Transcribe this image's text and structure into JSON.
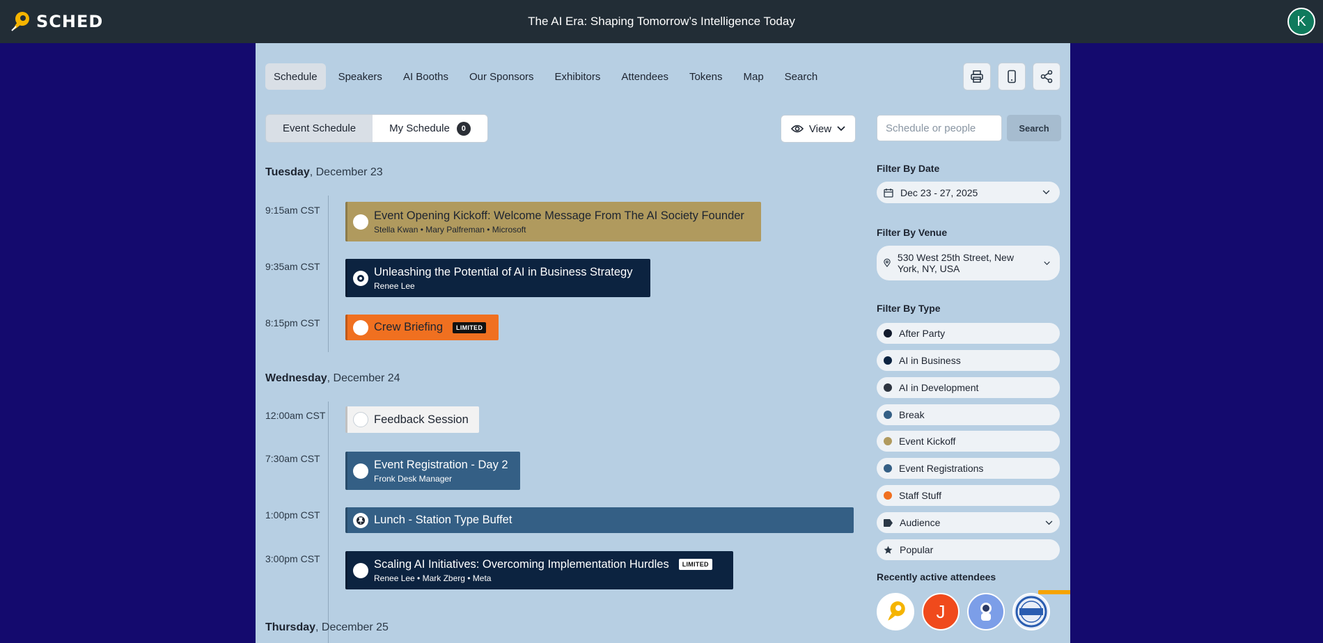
{
  "app": {
    "logo_text": "SCHED",
    "event_title": "The AI Era: Shaping Tomorrow’s Intelligence Today",
    "user_initial": "K"
  },
  "nav": {
    "tabs": [
      "Schedule",
      "Speakers",
      "AI Booths",
      "Our Sponsors",
      "Exhibitors",
      "Attendees",
      "Tokens",
      "Map",
      "Search"
    ],
    "active": "Schedule"
  },
  "toolbar": {
    "icons": [
      "printer-icon",
      "mobile-icon",
      "share-icon"
    ]
  },
  "schedule_tabs": {
    "event_schedule": "Event Schedule",
    "my_schedule": "My Schedule",
    "my_schedule_count": "0"
  },
  "view_button": {
    "label": "View"
  },
  "search": {
    "placeholder": "Schedule or people",
    "button": "Search"
  },
  "days": [
    {
      "weekday": "Tuesday",
      "date": ", December 23",
      "sessions": [
        {
          "time": "9:15am CST",
          "title": "Event Opening Kickoff: Welcome Message From The AI Society Founder",
          "subtitle": "Stella Kwan • Mary Palfreman • Microsoft",
          "color": "#b09a5e",
          "text_color": "#1d2430"
        },
        {
          "time": "9:35am CST",
          "title": "Unleashing the Potential of AI in Business Strategy",
          "subtitle": "Renee Lee",
          "color": "#0c2340",
          "text_color": "#ffffff"
        },
        {
          "time": "8:15pm CST",
          "title": "Crew Briefing",
          "badge": "LIMITED",
          "color": "#f07020",
          "text_color": "#1d2430"
        }
      ]
    },
    {
      "weekday": "Wednesday",
      "date": ", December 24",
      "sessions": [
        {
          "time": "12:00am CST",
          "title": "Feedback Session",
          "color": "#f2f2f2",
          "text_color": "#1d2430"
        },
        {
          "time": "7:30am CST",
          "title": "Event Registration - Day 2",
          "subtitle": "Fronk Desk Manager",
          "color": "#345f85",
          "text_color": "#ffffff"
        },
        {
          "time": "1:00pm CST",
          "title": "Lunch - Station Type Buffet",
          "color": "#345f85",
          "text_color": "#ffffff"
        },
        {
          "time": "3:00pm CST",
          "title": "Scaling AI Initiatives: Overcoming Implementation Hurdles",
          "subtitle": "Renee Lee • Mark Zberg • Meta",
          "badge": "LIMITED",
          "color": "#0c2340",
          "text_color": "#ffffff"
        }
      ]
    },
    {
      "weekday": "Thursday",
      "date": ", December 25"
    }
  ],
  "sidebar": {
    "filter_date_label": "Filter By Date",
    "filter_date_value": "Dec 23 - 27, 2025",
    "filter_venue_label": "Filter By Venue",
    "filter_venue_value": "530 West 25th Street, New York, NY, USA",
    "filter_type_label": "Filter By Type",
    "types": [
      {
        "name": "After Party",
        "color": "#111a2c"
      },
      {
        "name": "AI in Business",
        "color": "#0c2340"
      },
      {
        "name": "AI in Development",
        "color": "#2e3540"
      },
      {
        "name": "Break",
        "color": "#345f85"
      },
      {
        "name": "Event Kickoff",
        "color": "#b09a5e"
      },
      {
        "name": "Event Registrations",
        "color": "#345f85"
      },
      {
        "name": "Staff Stuff",
        "color": "#f07020"
      }
    ],
    "audience_label": "Audience",
    "popular_label": "Popular",
    "recent_label": "Recently active attendees",
    "attendees": [
      {
        "name": "sched-logo-avatar",
        "initial": ""
      },
      {
        "name": "initial-avatar",
        "initial": "J"
      },
      {
        "name": "astronaut-avatar",
        "initial": ""
      },
      {
        "name": "sample-stamp-avatar",
        "initial": ""
      }
    ]
  }
}
